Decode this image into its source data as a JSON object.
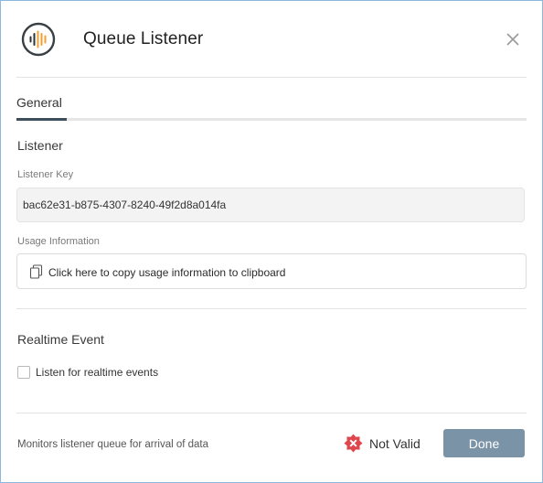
{
  "dialog": {
    "title": "Queue Listener",
    "app_icon": "audio-waveform-icon",
    "close_icon": "close-icon"
  },
  "tabs": [
    {
      "label": "General",
      "active": true
    }
  ],
  "listener": {
    "section_title": "Listener",
    "key_label": "Listener Key",
    "key_value": "bac62e31-b875-4307-8240-49f2d8a014fa",
    "usage_label": "Usage Information",
    "usage_action": "Click here to copy usage information to clipboard",
    "usage_icon": "copy-icon"
  },
  "realtime": {
    "section_title": "Realtime Event",
    "checkbox_label": "Listen for realtime events",
    "checked": false
  },
  "footer": {
    "description": "Monitors listener queue for arrival of data",
    "status_text": "Not Valid",
    "status_icon": "error-badge-icon",
    "done_label": "Done"
  },
  "colors": {
    "accent": "#3d4f5c",
    "button": "#7b93a6",
    "error": "#e0474c",
    "icon_orange": "#f0a030"
  }
}
